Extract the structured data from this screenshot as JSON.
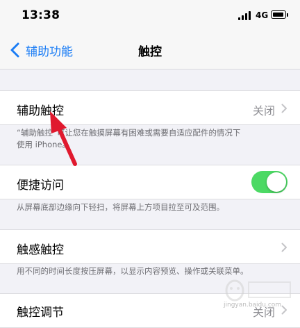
{
  "status_bar": {
    "time": "13:38",
    "network": "4G"
  },
  "nav": {
    "back_label": "辅助功能",
    "title": "触控"
  },
  "rows": {
    "assistive_touch": {
      "label": "辅助触控",
      "value": "关闭"
    },
    "reachability": {
      "label": "便捷访问",
      "toggle_on": true
    },
    "haptic_touch": {
      "label": "触感触控"
    },
    "touch_accommodations": {
      "label": "触控调节",
      "value": "关闭"
    }
  },
  "footnotes": {
    "assistive_touch_line1": "“辅助触控”可让您在触摸屏幕有困难或需要自适应配件的情况下",
    "assistive_touch_line2": "使用 iPhone。",
    "reachability": "从屏幕底部边缘向下轻扫，将屏幕上方项目拉至可及范围。",
    "haptic_touch": "用不同的时间长度按压屏幕，以显示内容预览、操作或关联菜单。"
  },
  "watermark": {
    "text": "jingyan.baidu.com"
  },
  "colors": {
    "accent": "#1a7cf5",
    "toggle_on": "#4cd964",
    "annotation_arrow": "#e0192e"
  }
}
